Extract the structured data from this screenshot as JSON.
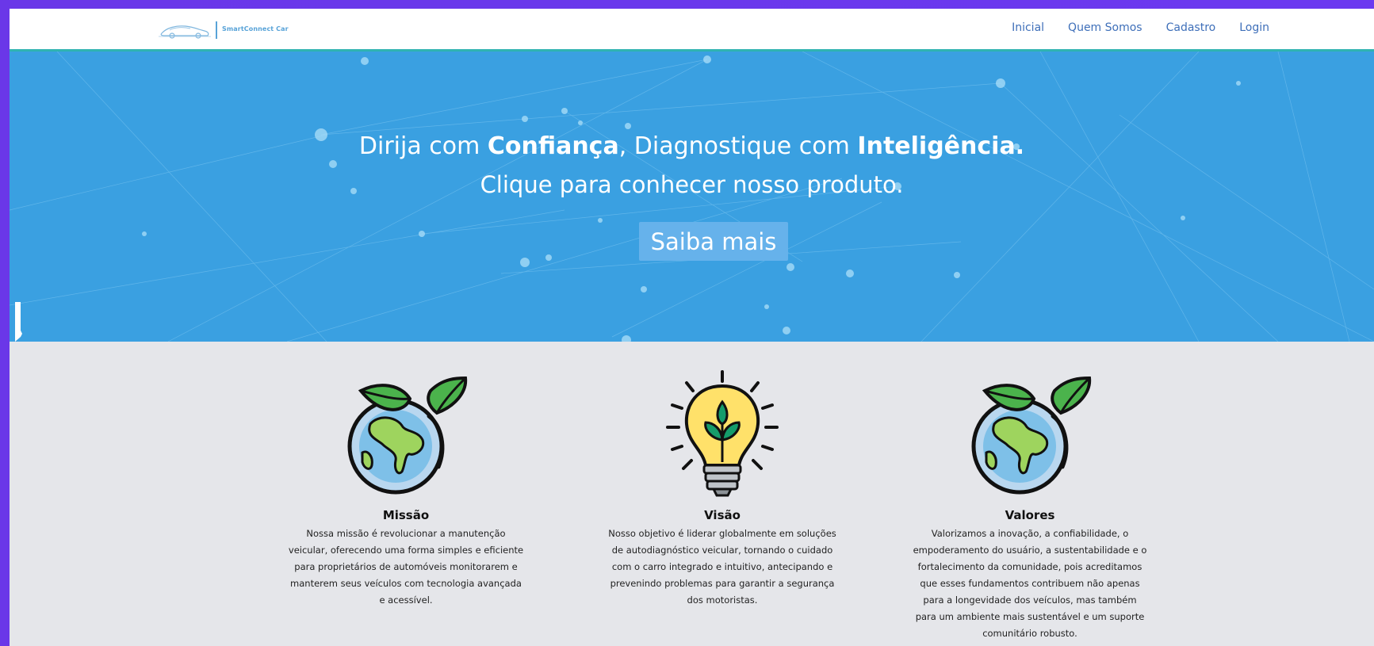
{
  "brand": {
    "name": "SmartConnect Car",
    "logo_icon": "car-outline-icon"
  },
  "nav": {
    "items": [
      "Inicial",
      "Quem Somos",
      "Cadastro",
      "Login"
    ]
  },
  "hero": {
    "line1_pre": "Dirija com ",
    "line1_bold1": "Confiança",
    "line1_mid": ", Diagnostique com ",
    "line1_bold2": "Inteligência.",
    "line2": "Clique para conhecer nosso produto.",
    "cta": "Saiba mais"
  },
  "features": [
    {
      "title": "Missão",
      "icon": "globe-leaf-icon",
      "text": "Nossa missão é revolucionar a manutenção veicular, oferecendo uma forma simples e eficiente para proprietários de automóveis monitorarem e manterem seus veículos com tecnologia avançada e acessível."
    },
    {
      "title": "Visão",
      "icon": "lightbulb-plant-icon",
      "text": "Nosso objetivo é liderar globalmente em soluções de autodiagnóstico veicular, tornando o cuidado com o carro integrado e intuitivo, antecipando e prevenindo problemas para garantir a segurança dos motoristas."
    },
    {
      "title": "Valores",
      "icon": "globe-leaf-icon",
      "text": "Valorizamos a inovação, a confiabilidade, o empoderamento do usuário, a sustentabilidade e o fortalecimento da comunidade, pois acreditamos que esses fundamentos contribuem não apenas para a longevidade dos veículos, mas também para um ambiente mais sustentável e um suporte comunitário robusto."
    }
  ],
  "colors": {
    "nav_link": "#3e6fb9",
    "hero_bg": "#3aa0e1",
    "cta_bg": "#66b2eb",
    "section_bg": "#e5e6ea",
    "nav_border": "#2fb3b1"
  }
}
